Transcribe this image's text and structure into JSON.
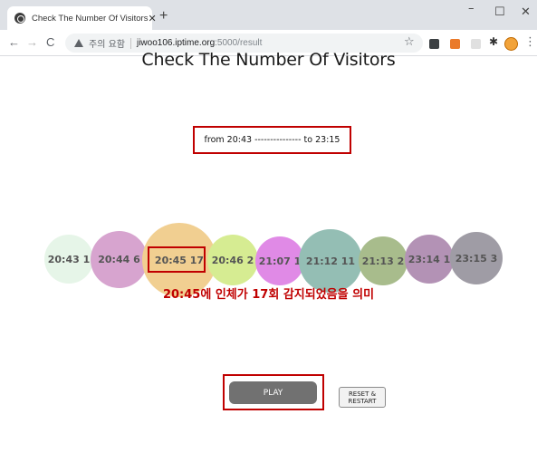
{
  "browser": {
    "tab_title": "Check The Number Of Visitors",
    "tab_close": "✕",
    "new_tab": "+",
    "window_controls": {
      "minimize": "–",
      "maximize": "☐",
      "close": "✕"
    },
    "nav": {
      "back": "←",
      "forward": "→",
      "reload": "C"
    },
    "security_label": "주의 요함",
    "url_host": "jiwoo106.iptime.org",
    "url_path": ":5000/result",
    "bookmark_star": "☆",
    "extensions_icon": "✱",
    "menu": "⋮"
  },
  "page": {
    "title": "Check The Number Of Visitors",
    "range": "from 20:43 --------------- to 23:15",
    "bubbles": [
      {
        "label": "20:43 1",
        "time": "20:43",
        "count": 1,
        "color": "#e6f5e8"
      },
      {
        "label": "20:44 6",
        "time": "20:44",
        "count": 6,
        "color": "#d7a4cf"
      },
      {
        "label": "20:45 17",
        "time": "20:45",
        "count": 17,
        "color": "#f1cf91"
      },
      {
        "label": "20:46 2",
        "time": "20:46",
        "count": 2,
        "color": "#d6ec92"
      },
      {
        "label": "21:07 1",
        "time": "21:07",
        "count": 1,
        "color": "#e08ae6"
      },
      {
        "label": "21:12 11",
        "time": "21:12",
        "count": 11,
        "color": "#94beb4"
      },
      {
        "label": "21:13 2",
        "time": "21:13",
        "count": 2,
        "color": "#a8bc8c"
      },
      {
        "label": "23:14 1",
        "time": "23:14",
        "count": 1,
        "color": "#b392b5"
      },
      {
        "label": "23:15 3",
        "time": "23:15",
        "count": 3,
        "color": "#9f9ca5"
      }
    ],
    "annotation": "20:45에 인체가 17회 감지되었음을 의미",
    "play_label": "PLAY",
    "reset_label_line1": "RESET &",
    "reset_label_line2": "RESTART"
  },
  "colors": {
    "highlight": "#c00000",
    "play_button": "#717171"
  }
}
